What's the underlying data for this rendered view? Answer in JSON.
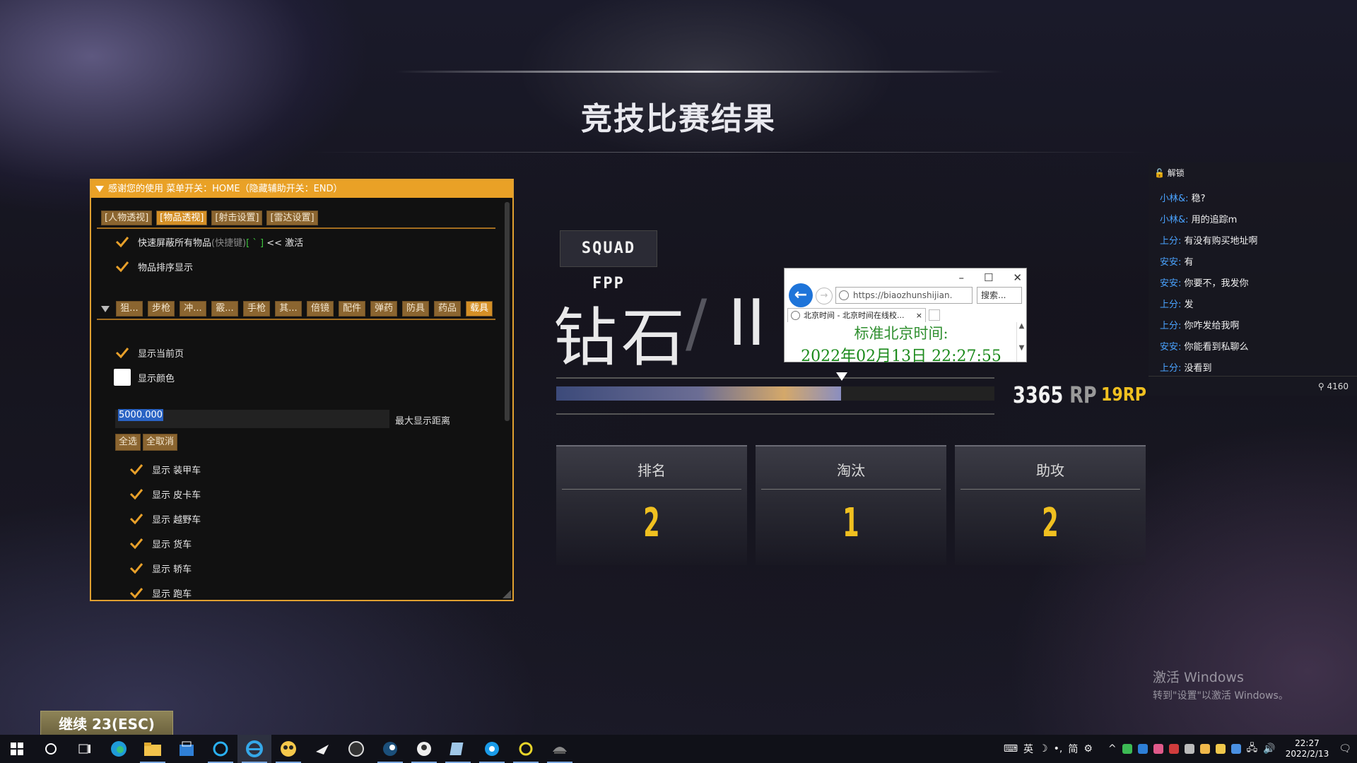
{
  "page": {
    "title": "竞技比赛结果",
    "continue_label": "继续 23(ESC)"
  },
  "cheat_panel": {
    "header": "感谢您的使用 菜单开关：HOME（隐藏辅助开关：END）",
    "top_tabs": [
      "[人物透视]",
      "[物品透视]",
      "[射击设置]",
      "[雷达设置]"
    ],
    "active_top_tab": 1,
    "quick_hide_label": "快速屏蔽所有物品",
    "quick_hide_hint": "(快捷键)",
    "quick_hide_key": "[ ` ]",
    "quick_hide_suffix": "<< 激活",
    "sort_label": "物品排序显示",
    "category_tabs": [
      "狙...",
      "步枪",
      "冲...",
      "霰...",
      "手枪",
      "其...",
      "倍镜",
      "配件",
      "弹药",
      "防具",
      "药品",
      "载具"
    ],
    "active_category": 11,
    "show_current_page": "显示当前页",
    "show_color": "显示颜色",
    "max_distance_value": "5000.000",
    "max_distance_label": "最大显示距离",
    "select_all": "全选",
    "deselect_all": "全取消",
    "vehicles": [
      "显示 装甲车",
      "显示 皮卡车",
      "显示 越野车",
      "显示 货车",
      "显示 轿车",
      "显示 跑车"
    ]
  },
  "result": {
    "mode": "SQUAD FPP",
    "rank_name": "钻石",
    "rank_slash": "/",
    "rank_tier": "II",
    "progress_fraction": 0.65,
    "rp_total": "3365",
    "rp_unit": "RP",
    "rp_gain": "19",
    "rp_gain_unit": "RP",
    "stats": [
      {
        "label": "排名",
        "value": "2"
      },
      {
        "label": "淘汰",
        "value": "1"
      },
      {
        "label": "助攻",
        "value": "2"
      }
    ]
  },
  "browser": {
    "url": "https://biaozhunshijian.",
    "search_placeholder": "搜索...",
    "tab_title": "北京时间 - 北京时间在线校...",
    "line1": "标准北京时间:",
    "line2": "2022年02月13日 22:27:55"
  },
  "chat": {
    "unlock_label": "解锁",
    "messages": [
      {
        "who": "小林&:",
        "text": "稳?"
      },
      {
        "who": "小林&:",
        "text": "用的追踪m"
      },
      {
        "who": "上分:",
        "text": "有没有购买地址啊"
      },
      {
        "who": "安安:",
        "text": "有"
      },
      {
        "who": "安安:",
        "text": "你要不，我发你"
      },
      {
        "who": "上分:",
        "text": "发"
      },
      {
        "who": "上分:",
        "text": "你咋发给我啊"
      },
      {
        "who": "安安:",
        "text": "你能看到私聊么"
      },
      {
        "who": "上分:",
        "text": "没看到"
      }
    ],
    "viewer_count": "4160"
  },
  "watermark": {
    "line1": "激活 Windows",
    "line2": "转到\"设置\"以激活 Windows。"
  },
  "taskbar": {
    "apps": [
      "start-icon",
      "cortana-search-icon",
      "task-view-icon",
      "edge-icon",
      "file-explorer-icon",
      "store-icon",
      "app-blue-icon",
      "ie-icon",
      "game-avatar-icon",
      "app-plane-icon",
      "obs-icon",
      "steam-icon",
      "app-circle-icon",
      "app-book-icon",
      "app-q-icon",
      "app-ring-icon",
      "pubg-icon"
    ],
    "ime": "英",
    "ime2": "简",
    "time": "22:27",
    "date": "2022/2/13"
  },
  "colors": {
    "accent_orange": "#e9a126",
    "gold": "#f0c020",
    "chat_name_blue": "#4aa3ff"
  }
}
